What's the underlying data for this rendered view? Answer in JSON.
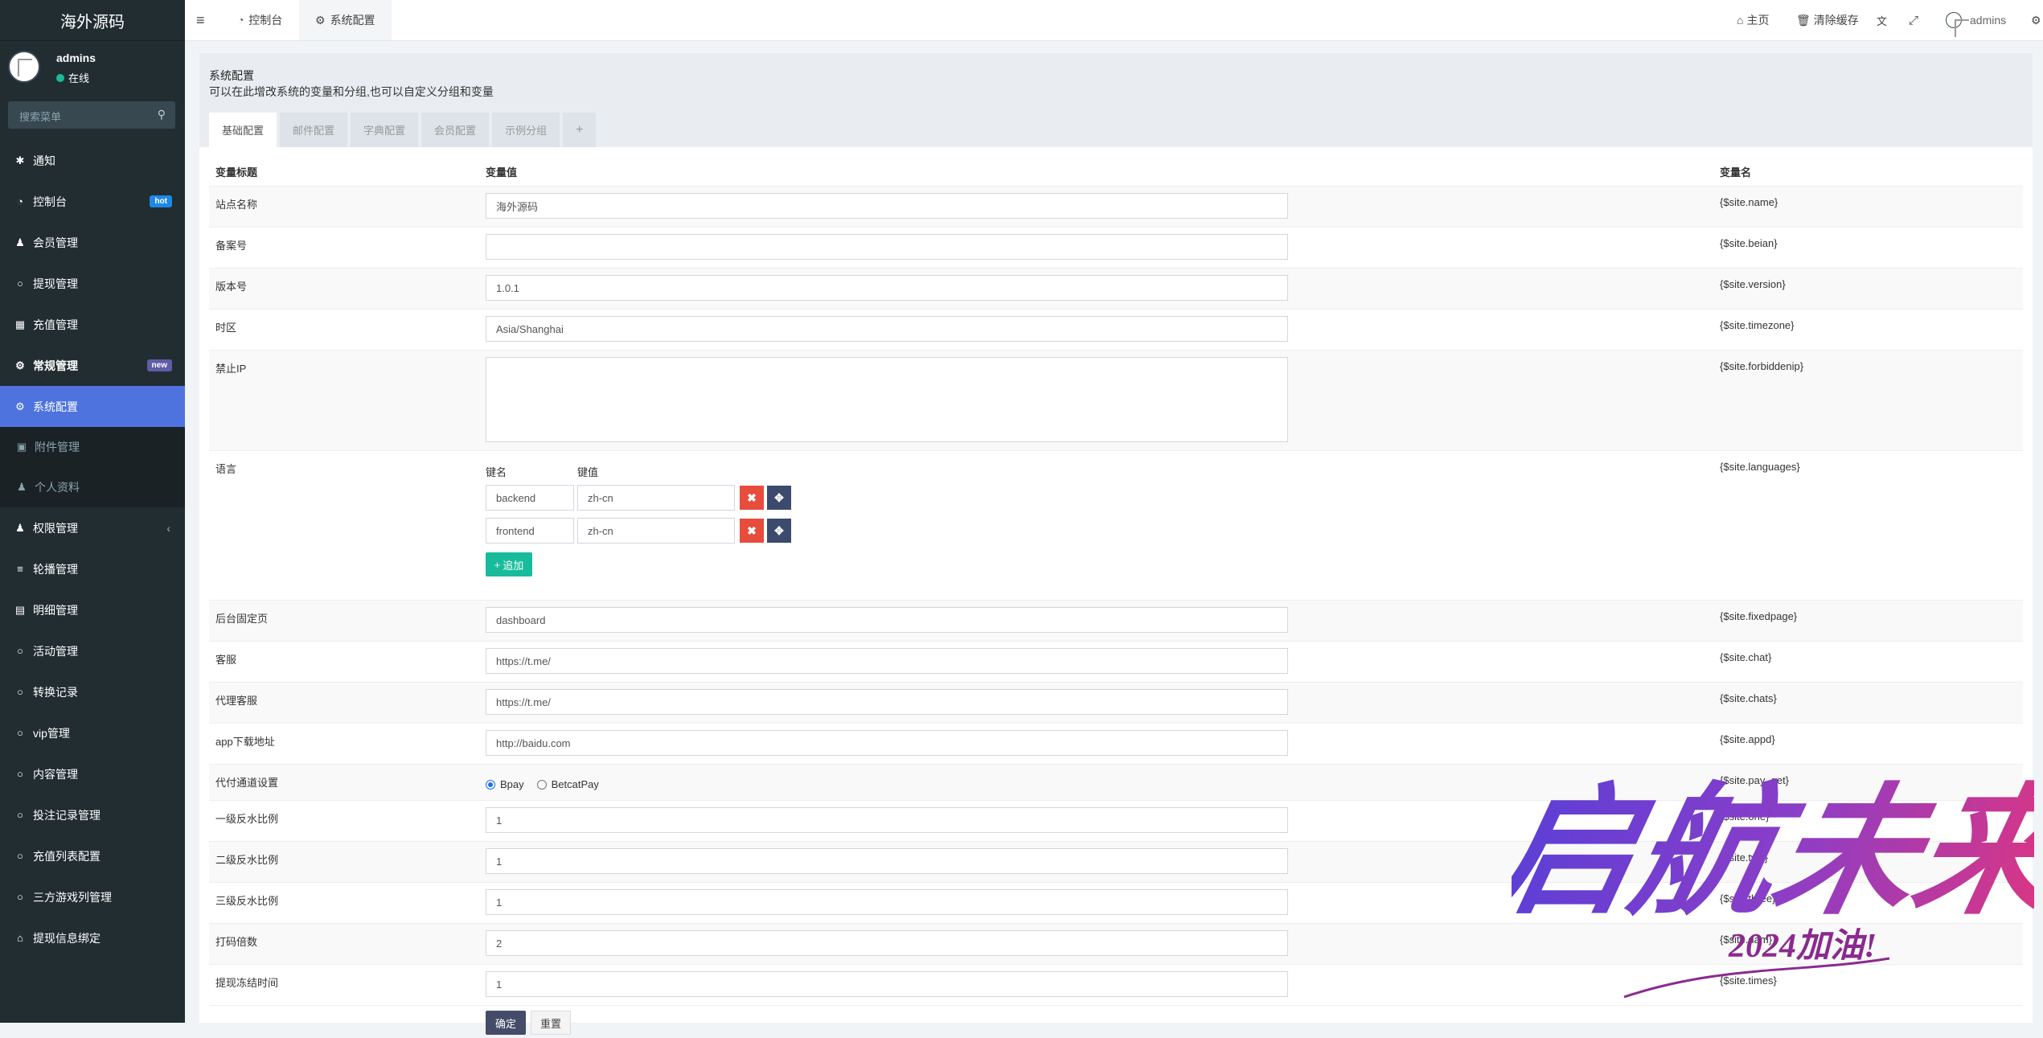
{
  "sidebar": {
    "logo": "海外源码",
    "user": {
      "name": "admins",
      "status": "在线"
    },
    "search_placeholder": "搜索菜单",
    "items": [
      {
        "label": "通知",
        "icon": "asterisk-icon"
      },
      {
        "label": "控制台",
        "icon": "dashboard-icon",
        "badge": "hot"
      },
      {
        "label": "会员管理",
        "icon": "users-icon"
      },
      {
        "label": "提现管理",
        "icon": "circle-icon"
      },
      {
        "label": "充值管理",
        "icon": "grid-icon"
      },
      {
        "label": "常规管理",
        "icon": "cogs-icon",
        "badge": "new"
      },
      {
        "label": "系统配置",
        "icon": "gear-icon"
      },
      {
        "label": "附件管理",
        "icon": "file-image-icon"
      },
      {
        "label": "个人资料",
        "icon": "user-icon"
      },
      {
        "label": "权限管理",
        "icon": "users-icon"
      },
      {
        "label": "轮播管理",
        "icon": "list-icon"
      },
      {
        "label": "明细管理",
        "icon": "calendar-icon"
      },
      {
        "label": "活动管理",
        "icon": "circle-icon"
      },
      {
        "label": "转换记录",
        "icon": "circle-icon"
      },
      {
        "label": "vip管理",
        "icon": "circle-icon"
      },
      {
        "label": "内容管理",
        "icon": "circle-icon"
      },
      {
        "label": "投注记录管理",
        "icon": "circle-icon"
      },
      {
        "label": "充值列表配置",
        "icon": "circle-icon"
      },
      {
        "label": "三方游戏列管理",
        "icon": "circle-icon"
      },
      {
        "label": "提现信息绑定",
        "icon": "bank-icon"
      }
    ]
  },
  "topbar": {
    "tabs": [
      {
        "label": "控制台"
      },
      {
        "label": "系统配置"
      }
    ],
    "right": {
      "home": "主页",
      "clear_cache": "清除缓存",
      "user": "admins"
    }
  },
  "page": {
    "title": "系统配置",
    "subtitle": "可以在此增改系统的变量和分组,也可以自定义分组和变量",
    "tabs": [
      "基础配置",
      "邮件配置",
      "字典配置",
      "会员配置",
      "示例分组",
      "+"
    ],
    "columns": {
      "title": "变量标题",
      "value": "变量值",
      "name": "变量名"
    },
    "rows": [
      {
        "title": "站点名称",
        "value": "海外源码",
        "name": "{$site.name}"
      },
      {
        "title": "备案号",
        "value": "",
        "name": "{$site.beian}"
      },
      {
        "title": "版本号",
        "value": "1.0.1",
        "name": "{$site.version}"
      },
      {
        "title": "时区",
        "value": "Asia/Shanghai",
        "name": "{$site.timezone}"
      },
      {
        "title": "禁止IP",
        "value": "",
        "name": "{$site.forbiddenip}"
      },
      {
        "title": "语言",
        "name": "{$site.languages}"
      },
      {
        "title": "后台固定页",
        "value": "dashboard",
        "name": "{$site.fixedpage}"
      },
      {
        "title": "客服",
        "value": "https://t.me/",
        "name": "{$site.chat}"
      },
      {
        "title": "代理客服",
        "value": "https://t.me/",
        "name": "{$site.chats}"
      },
      {
        "title": "app下载地址",
        "value": "http://baidu.com",
        "name": "{$site.appd}"
      },
      {
        "title": "代付通道设置",
        "name": "{$site.pay_get}"
      },
      {
        "title": "一级反水比例",
        "value": "1",
        "name": "{$site.one}"
      },
      {
        "title": "二级反水比例",
        "value": "1",
        "name": "{$site.two}"
      },
      {
        "title": "三级反水比例",
        "value": "1",
        "name": "{$site.three}"
      },
      {
        "title": "打码倍数",
        "value": "2",
        "name": "{$site.dam}"
      },
      {
        "title": "提现冻结时间",
        "value": "1",
        "name": "{$site.times}"
      }
    ],
    "languages": {
      "key_header": "键名",
      "value_header": "键值",
      "entries": [
        {
          "key": "backend",
          "value": "zh-cn"
        },
        {
          "key": "frontend",
          "value": "zh-cn"
        }
      ],
      "add_label": "追加"
    },
    "pay_options": {
      "selected": "Bpay",
      "other": "BetcatPay"
    },
    "buttons": {
      "confirm": "确定",
      "reset": "重置"
    }
  },
  "watermark": {
    "text": "启航未来",
    "sub": "2024加油!"
  }
}
